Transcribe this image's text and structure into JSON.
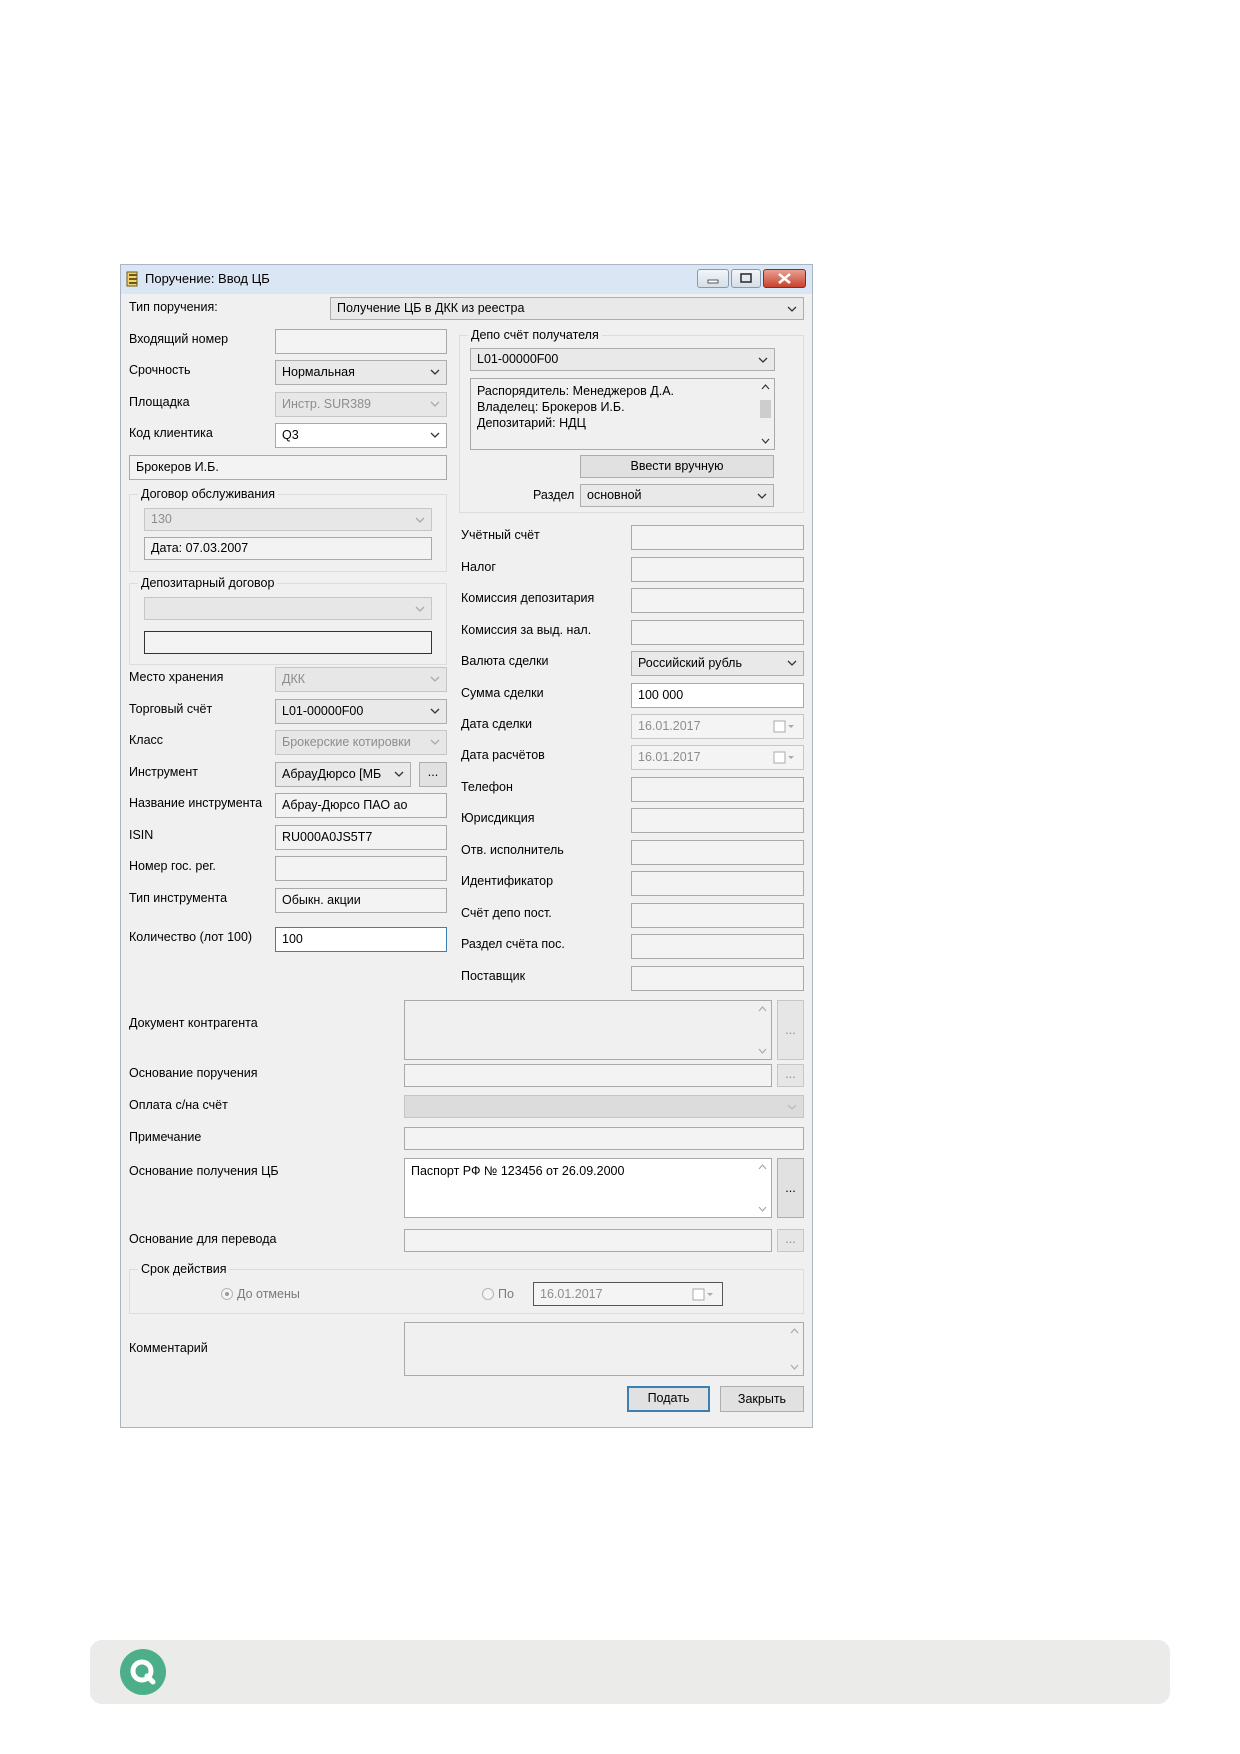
{
  "window": {
    "title": "Поручение: Ввод ЦБ",
    "minimize_icon": "minimize-icon",
    "maximize_icon": "maximize-icon",
    "close_icon": "close-icon"
  },
  "order_type": {
    "label": "Тип поручения:",
    "value": "Получение ЦБ в ДКК из реестра"
  },
  "left": {
    "incoming_number": {
      "label": "Входящий номер",
      "value": ""
    },
    "urgency": {
      "label": "Срочность",
      "value": "Нормальная"
    },
    "platform": {
      "label": "Площадка",
      "value": "Инстр. SUR389"
    },
    "client_code": {
      "label": "Код клиентика",
      "value": "Q3"
    },
    "client_name": "Брокеров И.Б.",
    "service_contract": {
      "title": "Договор обслуживания",
      "number": "130",
      "date": "Дата: 07.03.2007"
    },
    "depository_contract": {
      "title": "Депозитарный договор",
      "number": "",
      "info": ""
    },
    "storage_place": {
      "label": "Место хранения",
      "value": "ДКК"
    },
    "trading_account": {
      "label": "Торговый счёт",
      "value": "L01-00000F00"
    },
    "class": {
      "label": "Класс",
      "value": "Брокерские котировки"
    },
    "instrument": {
      "label": "Инструмент",
      "value": "АбрауДюрсо [МБ",
      "browse": "..."
    },
    "instrument_name": {
      "label": "Название инструмента",
      "value": "Абрау-Дюрсо ПАО ао"
    },
    "isin": {
      "label": "ISIN",
      "value": "RU000A0JS5T7"
    },
    "state_reg_number": {
      "label": "Номер гос. рег.",
      "value": ""
    },
    "instrument_type": {
      "label": "Тип инструмента",
      "value": "Обыкн. акции"
    },
    "quantity": {
      "label": "Количество (лот 100)",
      "value": "100"
    }
  },
  "right": {
    "depo_group_title": "Депо счёт получателя",
    "depo_account": "L01-00000F00",
    "depo_info": [
      "Распорядитель: Менеджеров Д.А.",
      "Владелец: Брокеров И.Б.",
      "Депозитарий: НДЦ"
    ],
    "manual_button": "Ввести вручную",
    "section": {
      "label": "Раздел",
      "value": "основной"
    },
    "accounting_account": {
      "label": "Учётный счёт",
      "value": ""
    },
    "tax": {
      "label": "Налог",
      "value": ""
    },
    "depository_fee": {
      "label": "Комиссия депозитария",
      "value": ""
    },
    "fee_tax": {
      "label": "Комиссия за выд. нал.",
      "value": ""
    },
    "currency": {
      "label": "Валюта сделки",
      "value": "Российский рубль"
    },
    "amount": {
      "label": "Сумма сделки",
      "value": "100 000"
    },
    "deal_date": {
      "label": "Дата сделки",
      "value": "16.01.2017"
    },
    "settlement_date": {
      "label": "Дата расчётов",
      "value": "16.01.2017"
    },
    "phone": {
      "label": "Телефон",
      "value": ""
    },
    "jurisdiction": {
      "label": "Юрисдикция",
      "value": ""
    },
    "executor": {
      "label": "Отв. исполнитель",
      "value": ""
    },
    "identifier": {
      "label": "Идентификатор",
      "value": ""
    },
    "supplier_depo": {
      "label": "Счёт депо пост.",
      "value": ""
    },
    "supplier_section": {
      "label": "Раздел счёта пос.",
      "value": ""
    },
    "supplier": {
      "label": "Поставщик",
      "value": ""
    }
  },
  "bottom": {
    "counterparty_doc": {
      "label": "Документ контрагента",
      "value": "",
      "browse": "..."
    },
    "order_basis": {
      "label": "Основание поручения",
      "value": "",
      "browse": "..."
    },
    "payment": {
      "label": "Оплата с/на счёт",
      "value": ""
    },
    "note": {
      "label": "Примечание",
      "value": ""
    },
    "receipt_basis": {
      "label": "Основание получения ЦБ",
      "value": "Паспорт РФ № 123456 от 26.09.2000",
      "browse": "..."
    },
    "transfer_basis": {
      "label": "Основание для перевода",
      "value": "",
      "browse": "..."
    },
    "validity": {
      "title": "Срок действия",
      "until_cancel": "До отмены",
      "until": "По",
      "date": "16.01.2017"
    },
    "comment": {
      "label": "Комментарий",
      "value": ""
    }
  },
  "buttons": {
    "submit": "Подать",
    "close": "Закрыть"
  },
  "footer": {
    "logo_icon": "q-logo-icon",
    "brand_color": "#4caf8a"
  }
}
